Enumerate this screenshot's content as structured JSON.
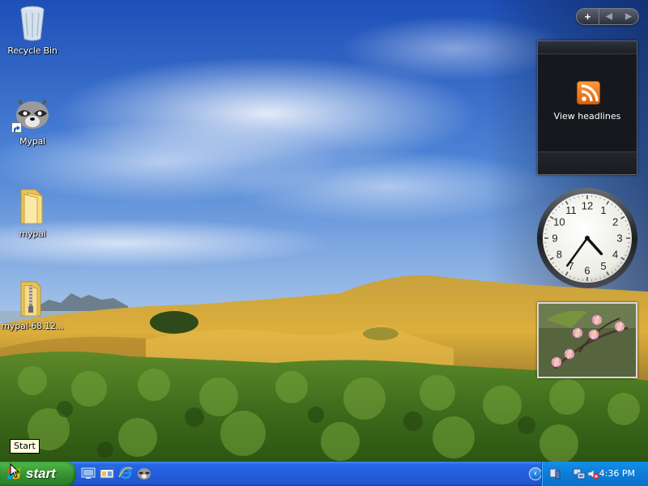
{
  "desktop": {
    "icons": [
      {
        "label": "Recycle Bin",
        "icon": "recycle-bin-icon"
      },
      {
        "label": "Mypal",
        "icon": "raccoon-browser-icon"
      },
      {
        "label": "mypal",
        "icon": "folder-icon"
      },
      {
        "label": "mypal-68.12...",
        "icon": "zip-archive-icon"
      }
    ]
  },
  "sidebar": {
    "add_label": "+",
    "prev_label": "◀",
    "next_label": "▶",
    "feed_gadget": {
      "label": "View headlines"
    },
    "clock_gadget": {
      "time": "4:36",
      "numerals": [
        "12",
        "1",
        "2",
        "3",
        "4",
        "5",
        "6",
        "7",
        "8",
        "9",
        "10",
        "11"
      ]
    },
    "slideshow_gadget": {
      "subject": "pink-flowers"
    }
  },
  "tooltip": {
    "text": "Start"
  },
  "taskbar": {
    "start_label": "start",
    "quick_launch": [
      "show-desktop-icon",
      "windows-explorer-icon",
      "internet-explorer-icon",
      "mypal-icon"
    ],
    "tray": {
      "expand_label": "‹",
      "icons": [
        "sidebar-tray-icon",
        "network-icon",
        "volume-muted-icon"
      ],
      "clock": "4:36 PM"
    }
  },
  "colors": {
    "taskbar": "#245edb",
    "start_button": "#3c9c37",
    "tray": "#0f80dc",
    "rss": "#f58220"
  }
}
